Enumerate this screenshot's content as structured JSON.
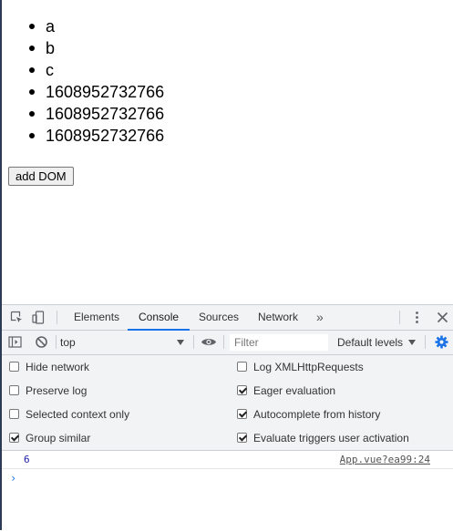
{
  "page": {
    "items": [
      "a",
      "b",
      "c",
      "1608952732766",
      "1608952732766",
      "1608952732766"
    ],
    "button_label": "add DOM"
  },
  "devtools": {
    "tabs": [
      "Elements",
      "Console",
      "Sources",
      "Network"
    ],
    "active_tab": "Console",
    "more_tabs_label": "»",
    "toolbar": {
      "context": "top",
      "filter_placeholder": "Filter",
      "levels": "Default levels"
    },
    "settings": {
      "left": [
        {
          "label": "Hide network",
          "checked": false
        },
        {
          "label": "Preserve log",
          "checked": false
        },
        {
          "label": "Selected context only",
          "checked": false
        },
        {
          "label": "Group similar",
          "checked": true
        }
      ],
      "right": [
        {
          "label": "Log XMLHttpRequests",
          "checked": false
        },
        {
          "label": "Eager evaluation",
          "checked": true
        },
        {
          "label": "Autocomplete from history",
          "checked": true
        },
        {
          "label": "Evaluate triggers user activation",
          "checked": true
        }
      ]
    },
    "console": {
      "message_value": "6",
      "message_source": "App.vue?ea99:24",
      "prompt": "›"
    },
    "colors": {
      "accent": "#1a73e8",
      "panel_bg": "#f1f3f4",
      "number_value": "#1a1aa6"
    },
    "icons": [
      "inspect-element-icon",
      "device-toolbar-icon",
      "kebab-menu-icon",
      "close-icon",
      "sidebar-toggle-icon",
      "clear-console-icon",
      "eye-icon",
      "gear-icon"
    ]
  }
}
